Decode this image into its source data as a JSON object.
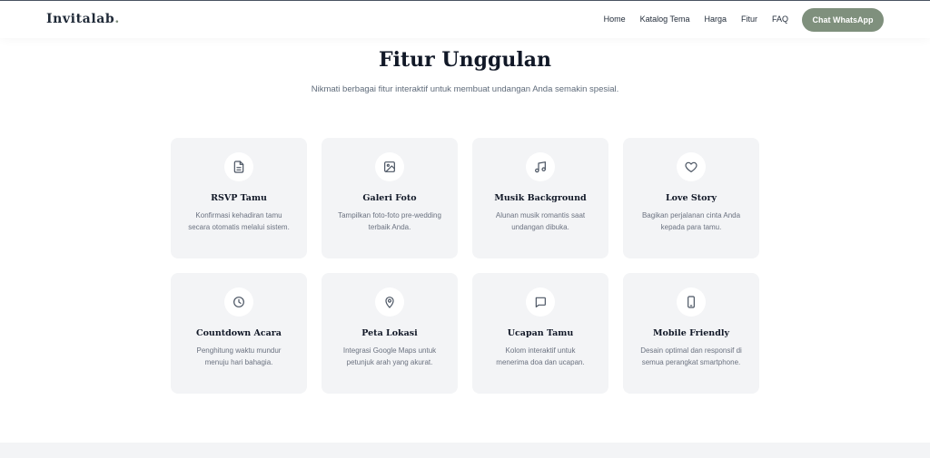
{
  "brand": {
    "name": "Invitalab",
    "suffix": "."
  },
  "nav": {
    "links": [
      "Home",
      "Katalog Tema",
      "Harga",
      "Fitur",
      "FAQ"
    ],
    "cta_label": "Chat WhatsApp"
  },
  "section": {
    "title": "Fitur Unggulan",
    "subtitle": "Nikmati berbagai fitur interaktif untuk membuat undangan Anda semakin spesial."
  },
  "features": [
    {
      "icon": "document-icon",
      "title": "RSVP Tamu",
      "description": "Konfirmasi kehadiran tamu secara otomatis melalui sistem."
    },
    {
      "icon": "image-icon",
      "title": "Galeri Foto",
      "description": "Tampilkan foto-foto pre-wedding terbaik Anda."
    },
    {
      "icon": "music-icon",
      "title": "Musik Background",
      "description": "Alunan musik romantis saat undangan dibuka."
    },
    {
      "icon": "heart-icon",
      "title": "Love Story",
      "description": "Bagikan perjalanan cinta Anda kepada para tamu."
    },
    {
      "icon": "clock-icon",
      "title": "Countdown Acara",
      "description": "Penghitung waktu mundur menuju hari bahagia."
    },
    {
      "icon": "map-pin-icon",
      "title": "Peta Lokasi",
      "description": "Integrasi Google Maps untuk petunjuk arah yang akurat."
    },
    {
      "icon": "message-icon",
      "title": "Ucapan Tamu",
      "description": "Kolom interaktif untuk menerima doa dan ucapan."
    },
    {
      "icon": "smartphone-icon",
      "title": "Mobile Friendly",
      "description": "Desain optimal dan responsif di semua perangkat smartphone."
    }
  ],
  "colors": {
    "accent": "#7f907d",
    "card_bg": "#f3f4f6",
    "text_dark": "#111827",
    "text_muted": "#6b7280"
  }
}
